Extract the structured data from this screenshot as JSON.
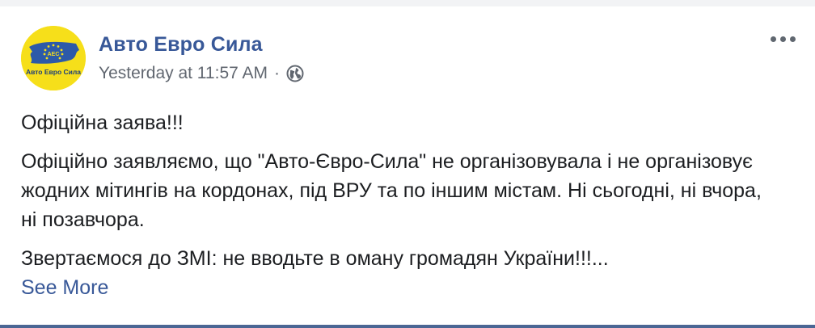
{
  "post": {
    "page_name": "Авто Евро Сила",
    "timestamp": "Yesterday at 11:57 AM",
    "separator": "·",
    "privacy_icon": "globe-icon",
    "menu_icon": "more-options-icon",
    "avatar": {
      "icon": "page-logo",
      "logo_text": "Авто Евро Сила",
      "logo_abbrev": "АЕС",
      "colors": {
        "background": "#f6df1a",
        "flag_blue": "#2d5aa8",
        "star": "#f6df1a"
      }
    },
    "paragraphs": [
      "Офіційна заява!!!",
      "Офіційно заявляємо, що \"Авто-Євро-Сила\" не організовувала і не організовує жодних мітингів на кордонах, під ВРУ та по іншим містам. Ні сьогодні, ні вчора, ні позавчора.",
      "Звертаємося до ЗМІ: не вводьте в оману громадян України!!!..."
    ],
    "see_more": "See More"
  },
  "colors": {
    "link": "#385898",
    "text": "#1c1e21",
    "meta": "#616770",
    "bottom_bar": "#4b6694"
  }
}
